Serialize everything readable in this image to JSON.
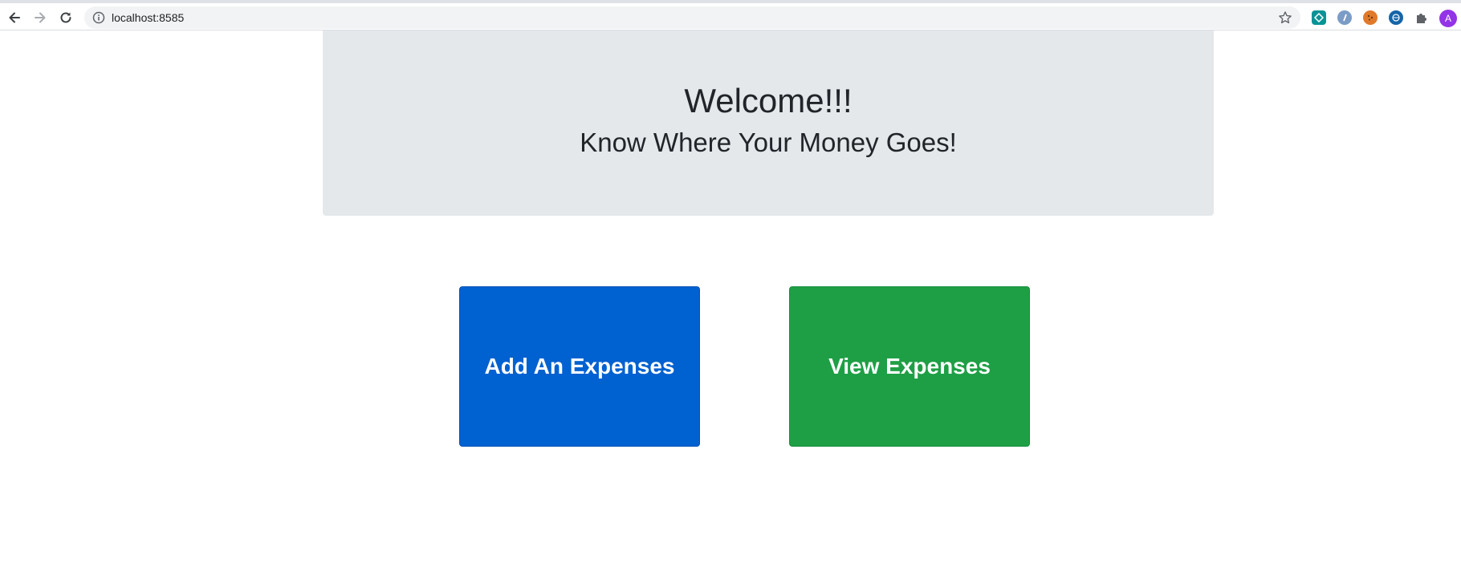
{
  "browser": {
    "url": "localhost:8585",
    "avatar_letter": "A",
    "icons": {
      "back": "back-arrow-icon",
      "forward": "forward-arrow-icon",
      "reload": "reload-icon",
      "info": "info-icon",
      "bookmark": "star-icon",
      "extensions": "puzzle-icon"
    }
  },
  "page": {
    "title": "Welcome!!!",
    "subtitle": "Know Where Your Money Goes!",
    "buttons": {
      "add_label": "Add An Expenses",
      "view_label": "View Expenses"
    }
  },
  "colors": {
    "jumbotron_bg": "#e4e8eb",
    "add_button": "#0061d0",
    "view_button": "#1e9f45",
    "text_dark": "#212529"
  }
}
